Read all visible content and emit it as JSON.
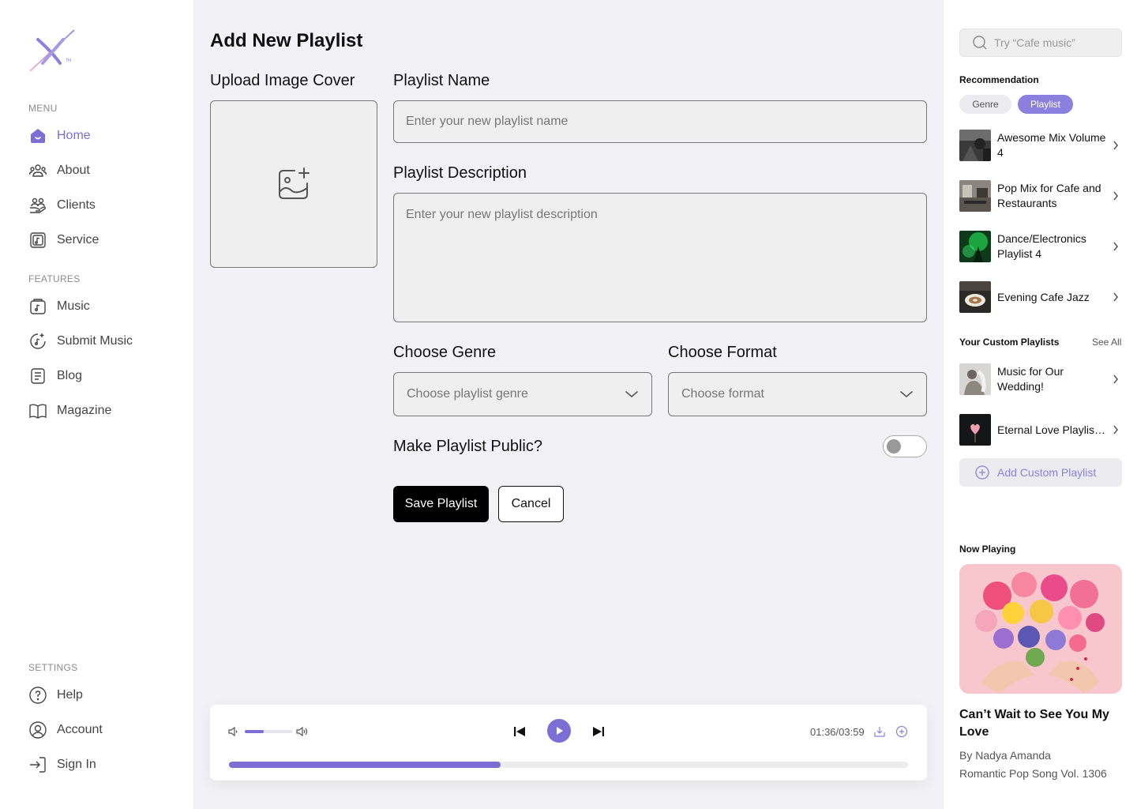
{
  "sidebar": {
    "menu_label": "MENU",
    "features_label": "FEATURES",
    "settings_label": "SETTINGS",
    "menu": [
      {
        "label": "Home",
        "icon": "home-icon",
        "active": true
      },
      {
        "label": "About",
        "icon": "people-icon"
      },
      {
        "label": "Clients",
        "icon": "clients-icon"
      },
      {
        "label": "Service",
        "icon": "service-icon"
      }
    ],
    "features": [
      {
        "label": "Music",
        "icon": "music-icon"
      },
      {
        "label": "Submit Music",
        "icon": "submit-music-icon"
      },
      {
        "label": "Blog",
        "icon": "blog-icon"
      },
      {
        "label": "Magazine",
        "icon": "book-icon"
      }
    ],
    "settings": [
      {
        "label": "Help",
        "icon": "help-icon"
      },
      {
        "label": "Account",
        "icon": "account-icon"
      },
      {
        "label": "Sign In",
        "icon": "sign-in-icon"
      }
    ]
  },
  "form": {
    "title": "Add New Playlist",
    "upload_label": "Upload Image Cover",
    "name_label": "Playlist Name",
    "name_placeholder": "Enter your new playlist name",
    "desc_label": "Playlist Description",
    "desc_placeholder": "Enter your new playlist description",
    "genre_label": "Choose Genre",
    "genre_placeholder": "Choose playlist genre",
    "format_label": "Choose Format",
    "format_placeholder": "Choose format",
    "public_label": "Make Playlist Public?",
    "public_on": false,
    "save_label": "Save Playlist",
    "cancel_label": "Cancel"
  },
  "player": {
    "time": "01:36/03:59",
    "progress": 0.4,
    "volume": 0.4
  },
  "right": {
    "search_placeholder": "Try “Cafe music”",
    "recommendation_heading": "Recommendation",
    "chips": {
      "genre": "Genre",
      "playlist": "Playlist",
      "active": "playlist"
    },
    "recommendations": [
      {
        "title": "Awesome Mix Volume 4"
      },
      {
        "title": "Pop Mix for Cafe and Restaurants"
      },
      {
        "title": "Dance/Electronics Playlist 4"
      },
      {
        "title": "Evening Cafe Jazz"
      }
    ],
    "custom_heading": "Your Custom Playlists",
    "see_all": "See All",
    "custom": [
      {
        "title": "Music for Our Wedding!"
      },
      {
        "title": "Eternal Love Playlist ‘Cause Our Love is..."
      }
    ],
    "add_custom_label": "Add Custom Playlist",
    "now_playing_heading": "Now Playing",
    "now_playing": {
      "title": "Can’t Wait to See You My Love",
      "artist_prefix": "By ",
      "artist": "Nadya Amanda",
      "album": "Romantic Pop Song Vol. 1306"
    }
  },
  "colors": {
    "accent": "#7b6fd6",
    "accent_light": "#8b80dd",
    "background": "#f2f2f6"
  }
}
